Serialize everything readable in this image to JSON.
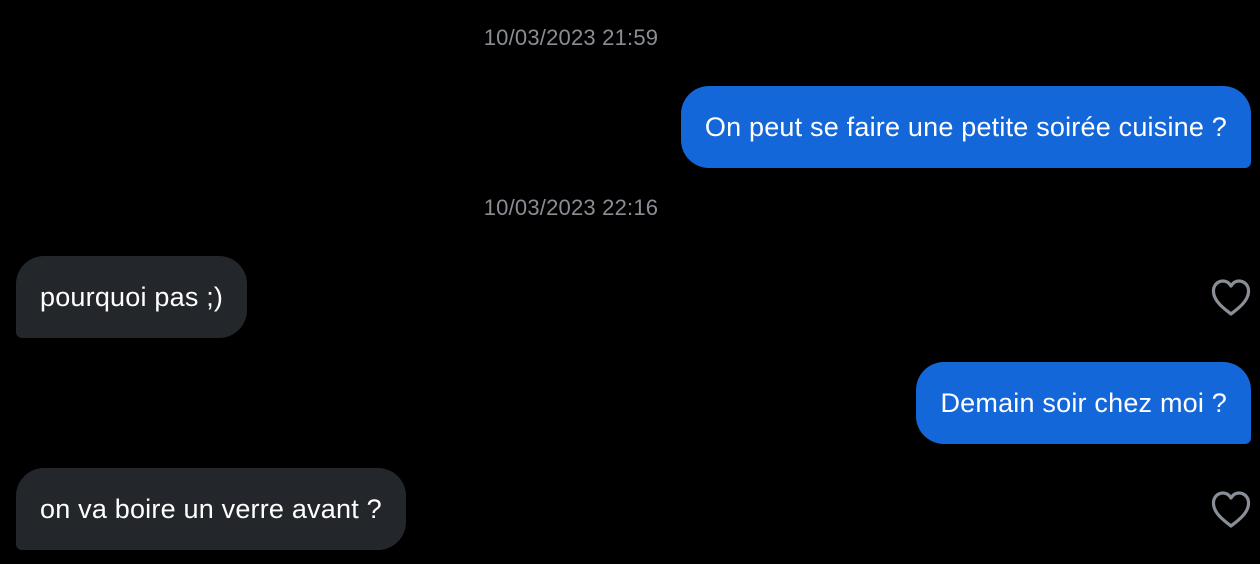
{
  "conversation": {
    "timestamps": [
      "10/03/2023 21:59",
      "10/03/2023 22:16"
    ],
    "messages": [
      {
        "direction": "sent",
        "text": "On peut se faire une petite soirée cuisine ?"
      },
      {
        "direction": "received",
        "text": "pourquoi pas ;)",
        "action_icon": "heart-outline-icon"
      },
      {
        "direction": "sent",
        "text": "Demain soir chez moi ?"
      },
      {
        "direction": "received",
        "text": "on va boire un verre avant ?",
        "action_icon": "heart-outline-icon"
      }
    ]
  },
  "colors": {
    "background": "#000000",
    "sent_bubble": "#1467d8",
    "received_bubble": "#23262b",
    "timestamp_text": "#8a8d93",
    "heart_icon": "#8a8f97"
  }
}
